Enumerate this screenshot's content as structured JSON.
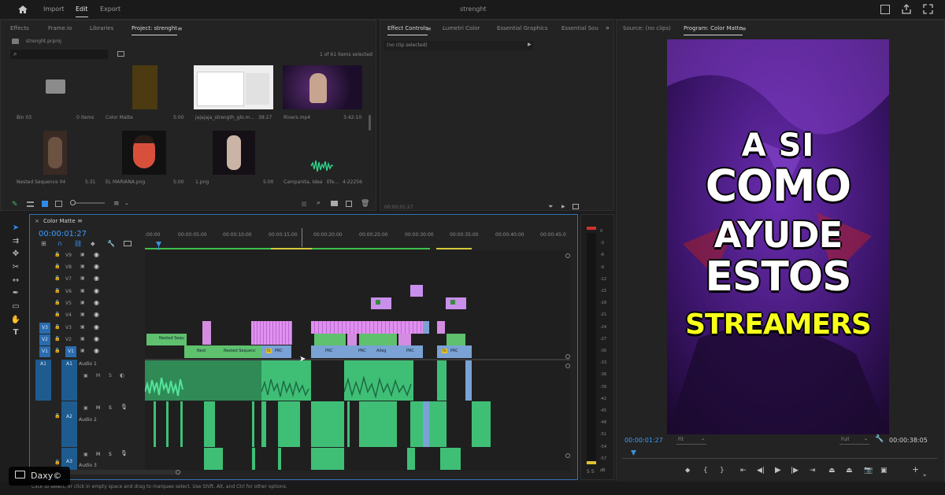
{
  "app": {
    "workspace_tabs": [
      "Import",
      "Edit",
      "Export"
    ],
    "project_title": "strenght"
  },
  "project_panel": {
    "tabs": [
      "Effects",
      "Frame.io",
      "Libraries",
      "Project: strenght"
    ],
    "file_name": "strenght.prproj",
    "search_placeholder": "",
    "items_selected": "1 of 61 items selected",
    "items": [
      {
        "name": "Bin 03",
        "meta": "0 items",
        "kind": "bin"
      },
      {
        "name": "Color Matte",
        "meta": "5:00",
        "kind": "color"
      },
      {
        "name": "jajajaja_strength_glo.m...",
        "meta": "38:27",
        "kind": "screen"
      },
      {
        "name": "Rivers.mp4",
        "meta": "3:42:10",
        "kind": "stream"
      },
      {
        "name": "Nested Sequence 04",
        "meta": "5:31",
        "kind": "nested"
      },
      {
        "name": "EL MARIANA.png",
        "meta": "5:00",
        "kind": "face"
      },
      {
        "name": "1.png",
        "meta": "5:00",
        "kind": "heart"
      },
      {
        "name": "Campanita, Idea",
        "meta2": "Efe...",
        "meta": "4:22256",
        "kind": "audio"
      }
    ]
  },
  "effect_controls": {
    "tabs": [
      "Effect Controls",
      "Lumetri Color",
      "Essential Graphics",
      "Essential Sou"
    ],
    "no_clip": "(no clip selected)",
    "timecode": "00:00:01:27"
  },
  "program_monitor": {
    "tabs": [
      "Source: (no clips)",
      "Program: Color Matte"
    ],
    "timecode": "00:00:01:27",
    "fit": "Fit",
    "quality": "Full",
    "duration": "00:00:38:05",
    "overlay_lines": [
      "A SI",
      "COMO",
      "AYUDE",
      "ESTOS",
      "STREAMERS"
    ],
    "overlay_highlight_color": "#f7ff1a"
  },
  "timeline": {
    "sequence_name": "Color Matte",
    "timecode": "00:00:01:27",
    "ruler": [
      ":00:00",
      "00:00:05:00",
      "00:00:10:00",
      "00:00:15:00",
      "00:00:20:00",
      "00:00:25:00",
      "00:00:30:00",
      "00:00:35:00",
      "00:00:40:00",
      "00:00:45:0"
    ],
    "video_tracks": [
      "V9",
      "V8",
      "V7",
      "V6",
      "V5",
      "V4",
      "V3",
      "V2",
      "V1"
    ],
    "audio_tracks": [
      {
        "id": "A1",
        "name": "Audio 1"
      },
      {
        "id": "A2",
        "name": "Audio 2"
      },
      {
        "id": "A3",
        "name": "Audio 3"
      }
    ],
    "clip_labels": {
      "nested_a": "Nested Sequ",
      "nested_b": "Nest",
      "nested_c": "Nested Sequenc",
      "prc": "PRC",
      "alleg": "Alleg",
      "fx": "fx"
    }
  },
  "meter_scale": [
    "0",
    "-3",
    "-6",
    "-9",
    "-12",
    "-15",
    "-18",
    "-21",
    "-24",
    "-27",
    "-30",
    "-33",
    "-36",
    "-39",
    "-42",
    "-45",
    "-48",
    "-51",
    "-54",
    "-57",
    "dB"
  ],
  "meter_solo": "S S",
  "status_bar": {
    "hint": "Click to select, or click in empty space and drag to marquee select. Use Shift, Alt, and Ctrl for other options."
  },
  "watermark": {
    "text": "Daxy©"
  },
  "colors": {
    "accent_blue": "#2d8ceb",
    "video_clip_pink": "#d48ce0",
    "video_clip_green": "#5fc06e",
    "audio_clip_green": "#3fbf76",
    "timeline_blue": "#3b8fd8",
    "highlight_yellow": "#f7ff1a"
  }
}
